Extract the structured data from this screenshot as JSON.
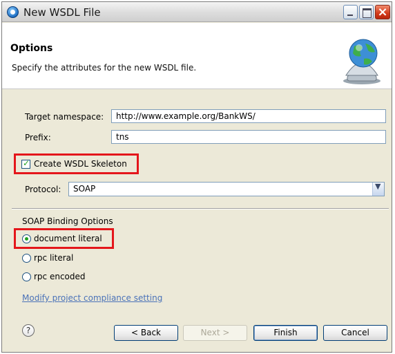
{
  "window": {
    "title": "New WSDL File"
  },
  "header": {
    "title": "Options",
    "description": "Specify the attributes for the new WSDL file."
  },
  "form": {
    "target_namespace_label": "Target namespace:",
    "target_namespace_value": "http://www.example.org/BankWS/",
    "prefix_label": "Prefix:",
    "prefix_value": "tns",
    "create_skeleton_label": "Create WSDL Skeleton",
    "create_skeleton_checked": true,
    "protocol_label": "Protocol:",
    "protocol_value": "SOAP"
  },
  "soap_binding": {
    "group_label": "SOAP Binding Options",
    "options": [
      {
        "label": "document literal",
        "selected": true
      },
      {
        "label": "rpc literal",
        "selected": false
      },
      {
        "label": "rpc encoded",
        "selected": false
      }
    ]
  },
  "link": {
    "label": "Modify project compliance setting"
  },
  "footer": {
    "help_label": "?",
    "back_label": "< Back",
    "next_label": "Next >",
    "finish_label": "Finish",
    "cancel_label": "Cancel"
  },
  "icons": {
    "app": "wsdl-app-icon",
    "wizard": "globe-service-bell-icon",
    "close": "×"
  },
  "colors": {
    "highlight": "#e4161b",
    "link": "#4a72b8",
    "check": "#21a121"
  }
}
